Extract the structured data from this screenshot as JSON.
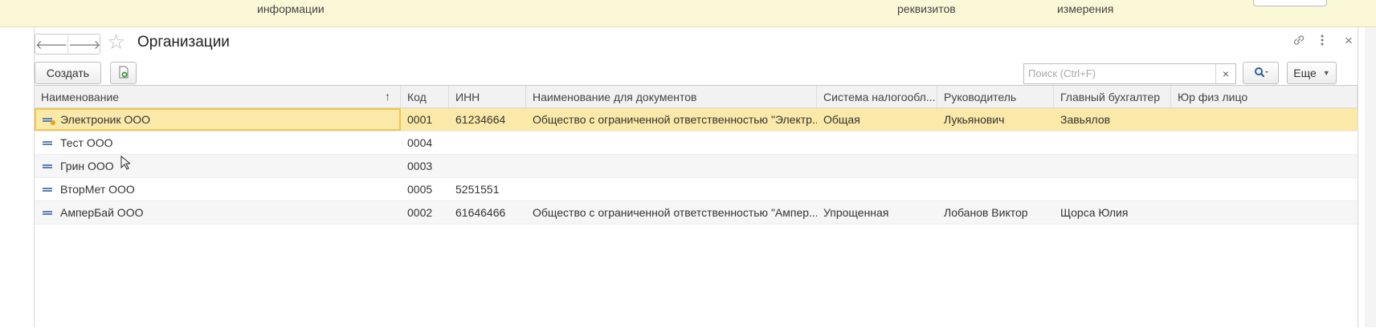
{
  "top_strip": {
    "labels": [
      "информации",
      "реквизитов",
      "измерения"
    ]
  },
  "window": {
    "title": "Организации",
    "nav": {
      "back_icon": "arrow-left-icon",
      "forward_icon": "arrow-right-icon"
    },
    "favorite_icon": "star-icon",
    "link_icon": "link-icon",
    "more_icon": "kebab-menu-icon",
    "close_icon": "close-icon"
  },
  "toolbar": {
    "create_label": "Создать",
    "create_group_icon": "add-group-icon",
    "search_placeholder": "Поиск (Ctrl+F)",
    "search_clear": "×",
    "search_icon": "magnifier-icon",
    "more_label": "Еще"
  },
  "grid": {
    "columns": [
      "Наименование",
      "Код",
      "ИНН",
      "Наименование для документов",
      "Система налогообл...",
      "Руководитель",
      "Главный бухгалтер",
      "Юр физ лицо"
    ],
    "sort_indicator": "↑",
    "rows": [
      [
        "Электроник ООО",
        "0001",
        "61234664",
        "Общество с ограниченной ответственностью \"Электр...",
        "Общая",
        "Лукьянович",
        "Завьялов",
        ""
      ],
      [
        "Тест ООО",
        "0004",
        "",
        "",
        "",
        "",
        "",
        ""
      ],
      [
        "Грин ООО",
        "0003",
        "",
        "",
        "",
        "",
        "",
        ""
      ],
      [
        "ВторМет ООО",
        "0005",
        "5251551",
        "",
        "",
        "",
        "",
        ""
      ],
      [
        "АмперБай ООО",
        "0002",
        "61646466",
        "Общество с ограниченной ответственностью \"Ампер...",
        "Упрощенная",
        "Лобанов Виктор",
        "Щорса Юлия",
        ""
      ]
    ],
    "selected_row": 0
  },
  "colors": {
    "top_strip_bg": "#fbf8d8",
    "selected_row_bg": "#fae9a8",
    "selected_cell_border": "#f1c64a",
    "row_icon": "#5b7fb0"
  }
}
